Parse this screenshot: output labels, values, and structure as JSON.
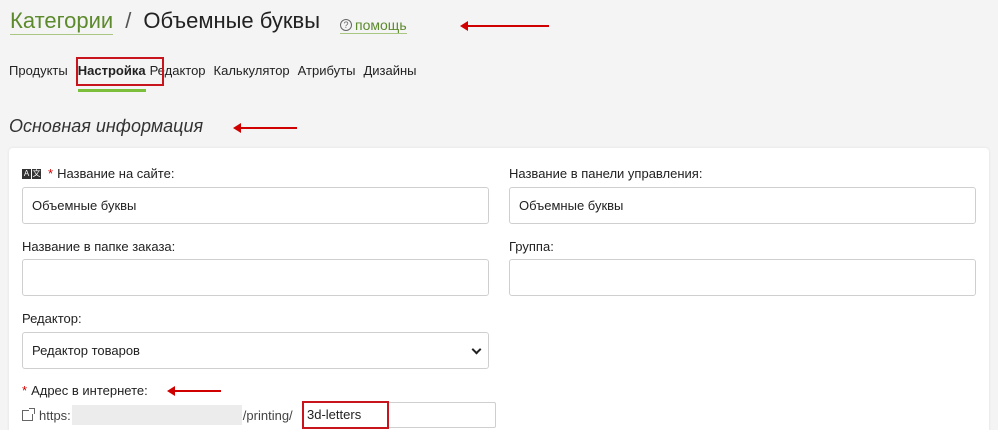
{
  "header": {
    "breadcrumb_link": "Категории",
    "separator": "/",
    "title": "Объемные буквы",
    "help_icon": "?",
    "help_label": "помощь"
  },
  "tabs": [
    "Продукты",
    "Настройка",
    "Редактор",
    "Калькулятор",
    "Атрибуты",
    "Дизайны"
  ],
  "active_tab": "Настройка",
  "section_title": "Основная информация",
  "form": {
    "lang_icon": [
      "A",
      "文"
    ],
    "site_name_label": "Название на сайте:",
    "site_name_value": "Объемные буквы",
    "admin_name_label": "Название в панели управления:",
    "admin_name_value": "Объемные буквы",
    "order_folder_label": "Название в папке заказа:",
    "order_folder_value": "",
    "group_label": "Группа:",
    "group_value": "",
    "editor_label": "Редактор:",
    "editor_value": "Редактор товаров",
    "url_label": "Адрес в интернете:",
    "url_prefix": "https:",
    "url_path": "/printing/",
    "url_slug": "3d-letters",
    "required_mark": "*"
  },
  "colors": {
    "accent_green": "#5c8a2c",
    "tab_underline": "#7bbf3a",
    "annotation_red": "#c8141c"
  }
}
